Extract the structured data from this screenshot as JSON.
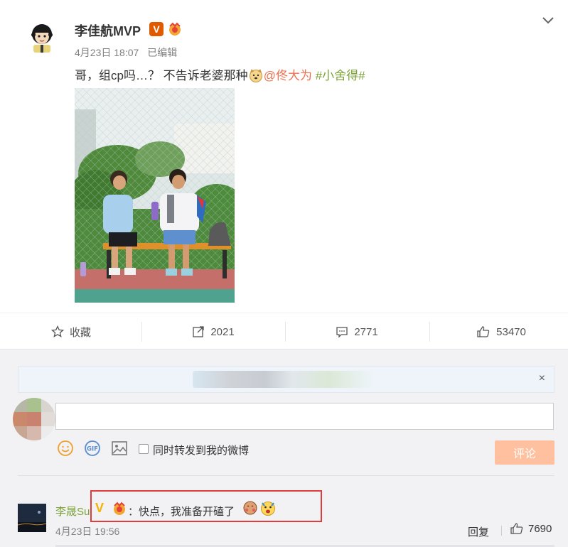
{
  "post": {
    "author": "李佳航MVP",
    "verified_badge": "V",
    "date": "4月23日 18:07",
    "edited": "已编辑",
    "text_main": "哥，组cp吗…？ 不告诉老婆那种",
    "mention": "@佟大为",
    "topic": "#小舍得#",
    "more_icon": "chevron-down-icon"
  },
  "actions": {
    "favorite": "收藏",
    "repost": "2021",
    "comment": "2771",
    "like": "53470"
  },
  "composer": {
    "close": "×",
    "input_value": "",
    "checkbox_label": "同时转发到我的微博",
    "submit": "评论"
  },
  "comment": {
    "user": "李晟Su",
    "text": "：快点，我准备开磕了",
    "time": "4月23日 19:56",
    "reply": "回复",
    "likes": "7690"
  },
  "colors": {
    "link_orange": "#eb7350",
    "topic_green": "#7ba238",
    "submit_disabled": "#ffc09f",
    "highlight_red": "#e03c3c",
    "panel_bg": "#f2f2f5"
  }
}
